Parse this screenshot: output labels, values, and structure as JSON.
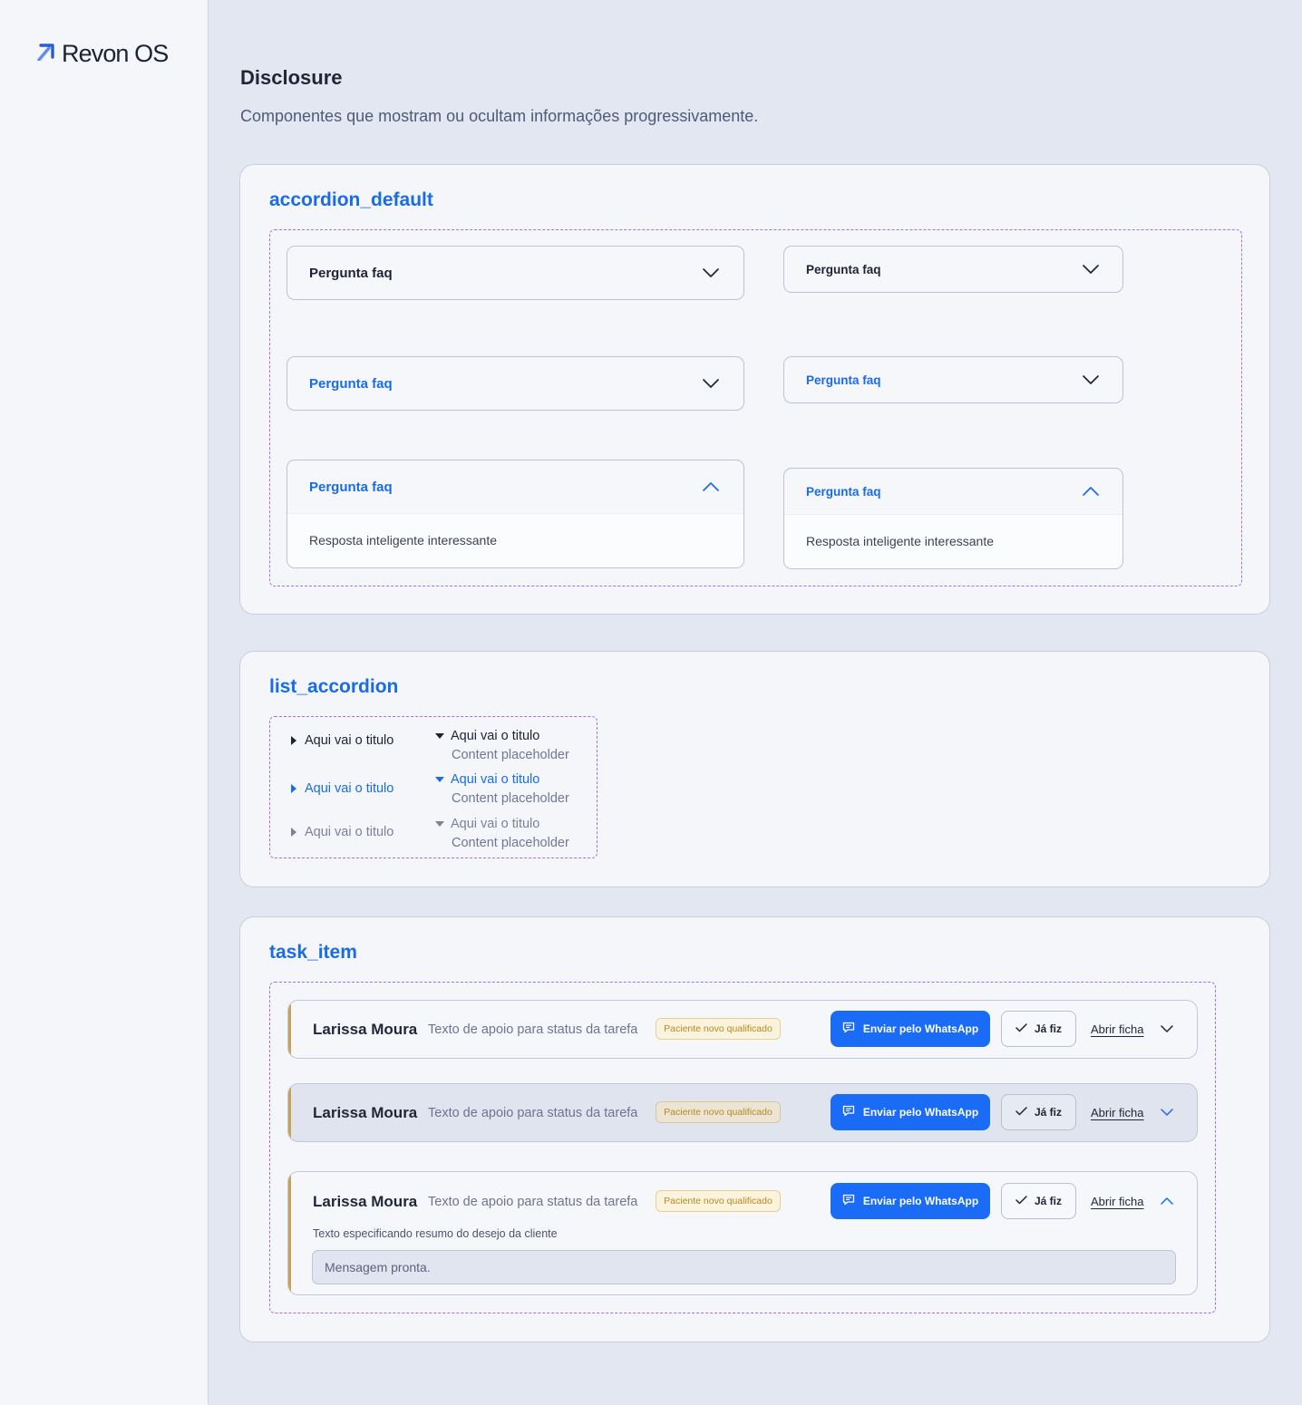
{
  "brand": {
    "name": "Revon OS"
  },
  "header": {
    "title": "Disclosure",
    "subtitle": "Componentes que mostram ou ocultam informações progressivamente."
  },
  "accordion_default": {
    "title": "accordion_default",
    "items": [
      {
        "label": "Pergunta faq",
        "state": "default"
      },
      {
        "label": "Pergunta faq",
        "state": "default"
      },
      {
        "label": "Pergunta faq",
        "state": "hover"
      },
      {
        "label": "Pergunta faq",
        "state": "hover"
      },
      {
        "label": "Pergunta faq",
        "state": "open",
        "answer": "Resposta inteligente interessante"
      },
      {
        "label": "Pergunta faq",
        "state": "open",
        "answer": "Resposta inteligente interessante"
      }
    ]
  },
  "list_accordion": {
    "title": "list_accordion",
    "items": [
      {
        "label": "Aqui vai o titulo",
        "state": "collapsed-default"
      },
      {
        "label": "Aqui vai o titulo",
        "content": "Content placeholder",
        "state": "expanded-default"
      },
      {
        "label": "Aqui vai o titulo",
        "state": "collapsed-active"
      },
      {
        "label": "Aqui vai o titulo",
        "content": "Content placeholder",
        "state": "expanded-active"
      },
      {
        "label": "Aqui vai o titulo",
        "state": "collapsed-disabled"
      },
      {
        "label": "Aqui vai o titulo",
        "content": "Content placeholder",
        "state": "expanded-disabled"
      }
    ]
  },
  "task_item": {
    "title": "task_item",
    "items": [
      {
        "name": "Larissa Moura",
        "description": "Texto de apoio para status da tarefa",
        "badge": "Paciente novo qualificado",
        "whatsapp_label": "Enviar pelo WhatsApp",
        "done_label": "Já fiz",
        "open_label": "Abrir ficha",
        "state": "default"
      },
      {
        "name": "Larissa Moura",
        "description": "Texto de apoio para status da tarefa",
        "badge": "Paciente novo qualificado",
        "whatsapp_label": "Enviar pelo WhatsApp",
        "done_label": "Já fiz",
        "open_label": "Abrir ficha",
        "state": "hover"
      },
      {
        "name": "Larissa Moura",
        "description": "Texto de apoio para status da tarefa",
        "badge": "Paciente novo qualificado",
        "whatsapp_label": "Enviar pelo WhatsApp",
        "done_label": "Já fiz",
        "open_label": "Abrir ficha",
        "state": "expanded",
        "summary": "Texto especificando resumo do desejo da cliente",
        "message": "Mensagem pronta."
      }
    ]
  },
  "colors": {
    "accent_blue": "#1a6be8",
    "button_blue": "#1a6bf5",
    "dashed_outline": "#a26ff0",
    "task_accent": "#c8a154",
    "badge_text": "#b48a23"
  }
}
